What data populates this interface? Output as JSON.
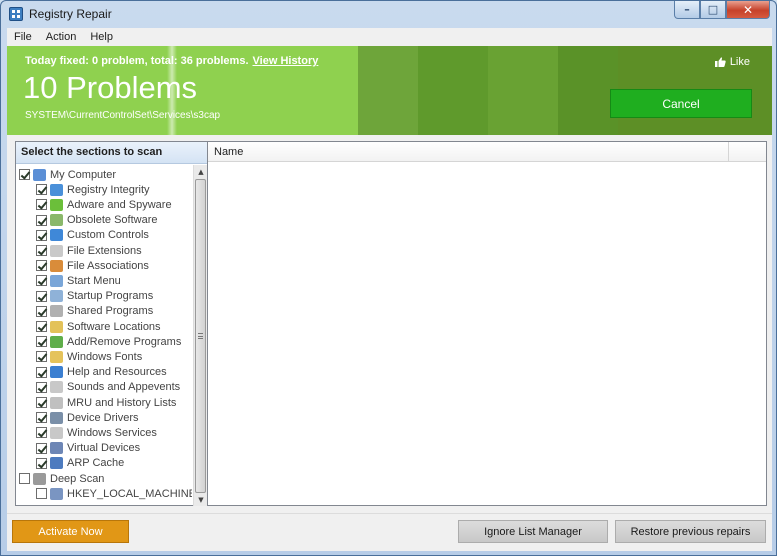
{
  "window": {
    "title": "Registry Repair",
    "controls": {
      "minimize": "–",
      "maximize": "□",
      "close": "✕"
    }
  },
  "menu": {
    "items": [
      "File",
      "Action",
      "Help"
    ]
  },
  "header": {
    "today_text": "Today fixed: 0 problem, total: 36 problems.",
    "view_history": "View History",
    "problems_title": "10 Problems",
    "current_path": "SYSTEM\\CurrentControlSet\\Services\\s3cap",
    "like_label": "Like",
    "cancel_label": "Cancel"
  },
  "sections": {
    "header": "Select the sections to scan",
    "items": [
      {
        "label": "My Computer",
        "checked": true,
        "level": 0,
        "icon": "computer-icon",
        "color": "#5b8fd6"
      },
      {
        "label": "Registry Integrity",
        "checked": true,
        "level": 1,
        "icon": "registry-icon",
        "color": "#4a90d9"
      },
      {
        "label": "Adware and Spyware",
        "checked": true,
        "level": 1,
        "icon": "adware-icon",
        "color": "#6bbf3a"
      },
      {
        "label": "Obsolete Software",
        "checked": true,
        "level": 1,
        "icon": "trash-icon",
        "color": "#8ab86a"
      },
      {
        "label": "Custom Controls",
        "checked": true,
        "level": 1,
        "icon": "controls-icon",
        "color": "#3f88d8"
      },
      {
        "label": "File Extensions",
        "checked": true,
        "level": 1,
        "icon": "file-icon",
        "color": "#c9c9c9"
      },
      {
        "label": "File Associations",
        "checked": true,
        "level": 1,
        "icon": "file-assoc-icon",
        "color": "#d98c3a"
      },
      {
        "label": "Start Menu",
        "checked": true,
        "level": 1,
        "icon": "start-menu-icon",
        "color": "#7aa6d8"
      },
      {
        "label": "Startup Programs",
        "checked": true,
        "level": 1,
        "icon": "startup-icon",
        "color": "#8fb2d8"
      },
      {
        "label": "Shared Programs",
        "checked": true,
        "level": 1,
        "icon": "shared-icon",
        "color": "#b0b0b0"
      },
      {
        "label": "Software Locations",
        "checked": true,
        "level": 1,
        "icon": "folder-icon",
        "color": "#e3c25a"
      },
      {
        "label": "Add/Remove Programs",
        "checked": true,
        "level": 1,
        "icon": "add-remove-icon",
        "color": "#5fae4a"
      },
      {
        "label": "Windows Fonts",
        "checked": true,
        "level": 1,
        "icon": "font-icon",
        "color": "#e5c35b"
      },
      {
        "label": "Help and Resources",
        "checked": true,
        "level": 1,
        "icon": "help-icon",
        "color": "#3b7fd1"
      },
      {
        "label": "Sounds and Appevents",
        "checked": true,
        "level": 1,
        "icon": "sound-icon",
        "color": "#c8c8c8"
      },
      {
        "label": "MRU and History Lists",
        "checked": true,
        "level": 1,
        "icon": "history-icon",
        "color": "#c0c0c0"
      },
      {
        "label": "Device Drivers",
        "checked": true,
        "level": 1,
        "icon": "device-icon",
        "color": "#7a8fa8"
      },
      {
        "label": "Windows Services",
        "checked": true,
        "level": 1,
        "icon": "services-icon",
        "color": "#c8c8c8"
      },
      {
        "label": "Virtual Devices",
        "checked": true,
        "level": 1,
        "icon": "virtual-device-icon",
        "color": "#6d86b5"
      },
      {
        "label": "ARP Cache",
        "checked": true,
        "level": 1,
        "icon": "arp-icon",
        "color": "#4d7bbf"
      },
      {
        "label": "Deep Scan",
        "checked": false,
        "level": 0,
        "icon": "deep-scan-icon",
        "color": "#9a9a9a"
      },
      {
        "label": "HKEY_LOCAL_MACHINE",
        "checked": false,
        "level": 1,
        "icon": "hklm-icon",
        "color": "#7a95c2"
      }
    ]
  },
  "results": {
    "columns": [
      "Name"
    ]
  },
  "footer": {
    "activate_label": "Activate Now",
    "ignore_list_label": "Ignore List Manager",
    "restore_label": "Restore previous repairs"
  },
  "colors": {
    "header_light": "#8fd14f",
    "header_dark": "#5c8f25",
    "cancel_green": "#1fae1f",
    "activate_orange": "#e19716"
  }
}
